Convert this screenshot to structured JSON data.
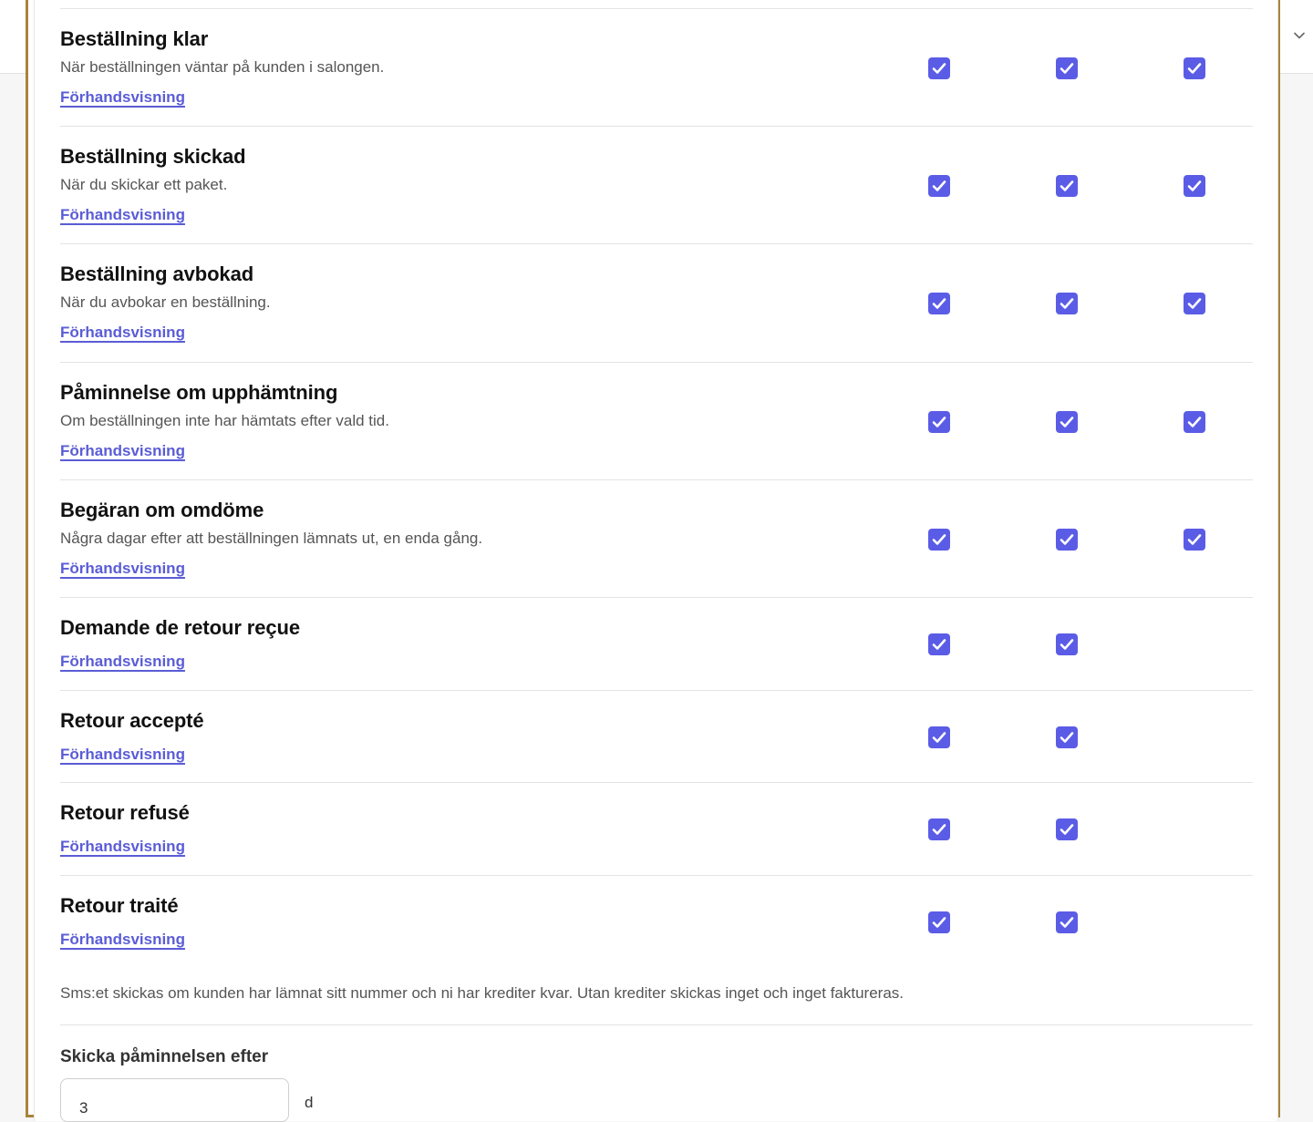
{
  "rows": [
    {
      "title": "Beställning klar",
      "description": "När beställningen väntar på kunden i salongen.",
      "link": "Förhandsvisning",
      "checks": [
        true,
        true,
        true
      ]
    },
    {
      "title": "Beställning skickad",
      "description": "När du skickar ett paket.",
      "link": "Förhandsvisning",
      "checks": [
        true,
        true,
        true
      ]
    },
    {
      "title": "Beställning avbokad",
      "description": "När du avbokar en beställning.",
      "link": "Förhandsvisning",
      "checks": [
        true,
        true,
        true
      ]
    },
    {
      "title": "Påminnelse om upphämtning",
      "description": "Om beställningen inte har hämtats efter vald tid.",
      "link": "Förhandsvisning",
      "checks": [
        true,
        true,
        true
      ]
    },
    {
      "title": "Begäran om omdöme",
      "description": "Några dagar efter att beställningen lämnats ut, en enda gång.",
      "link": "Förhandsvisning",
      "checks": [
        true,
        true,
        true
      ]
    },
    {
      "title": "Demande de retour reçue",
      "description": "",
      "link": "Förhandsvisning",
      "checks": [
        true,
        true
      ]
    },
    {
      "title": "Retour accepté",
      "description": "",
      "link": "Förhandsvisning",
      "checks": [
        true,
        true
      ]
    },
    {
      "title": "Retour refusé",
      "description": "",
      "link": "Förhandsvisning",
      "checks": [
        true,
        true
      ]
    },
    {
      "title": "Retour traité",
      "description": "",
      "link": "Förhandsvisning",
      "checks": [
        true,
        true
      ]
    }
  ],
  "note": "Sms:et skickas om kunden har lämnat sitt nummer och ni har krediter kvar. Utan krediter skickas inget och inget faktureras.",
  "reminder": {
    "label": "Skicka påminnelsen efter",
    "value": "3",
    "unit": "d"
  },
  "icons": {
    "checkbox": "checkmark-icon",
    "header": "chevron-down-icon"
  },
  "colors": {
    "checkbox": "#5b5ce6",
    "link": "#5a5cd6",
    "frame": "#a8843a"
  }
}
